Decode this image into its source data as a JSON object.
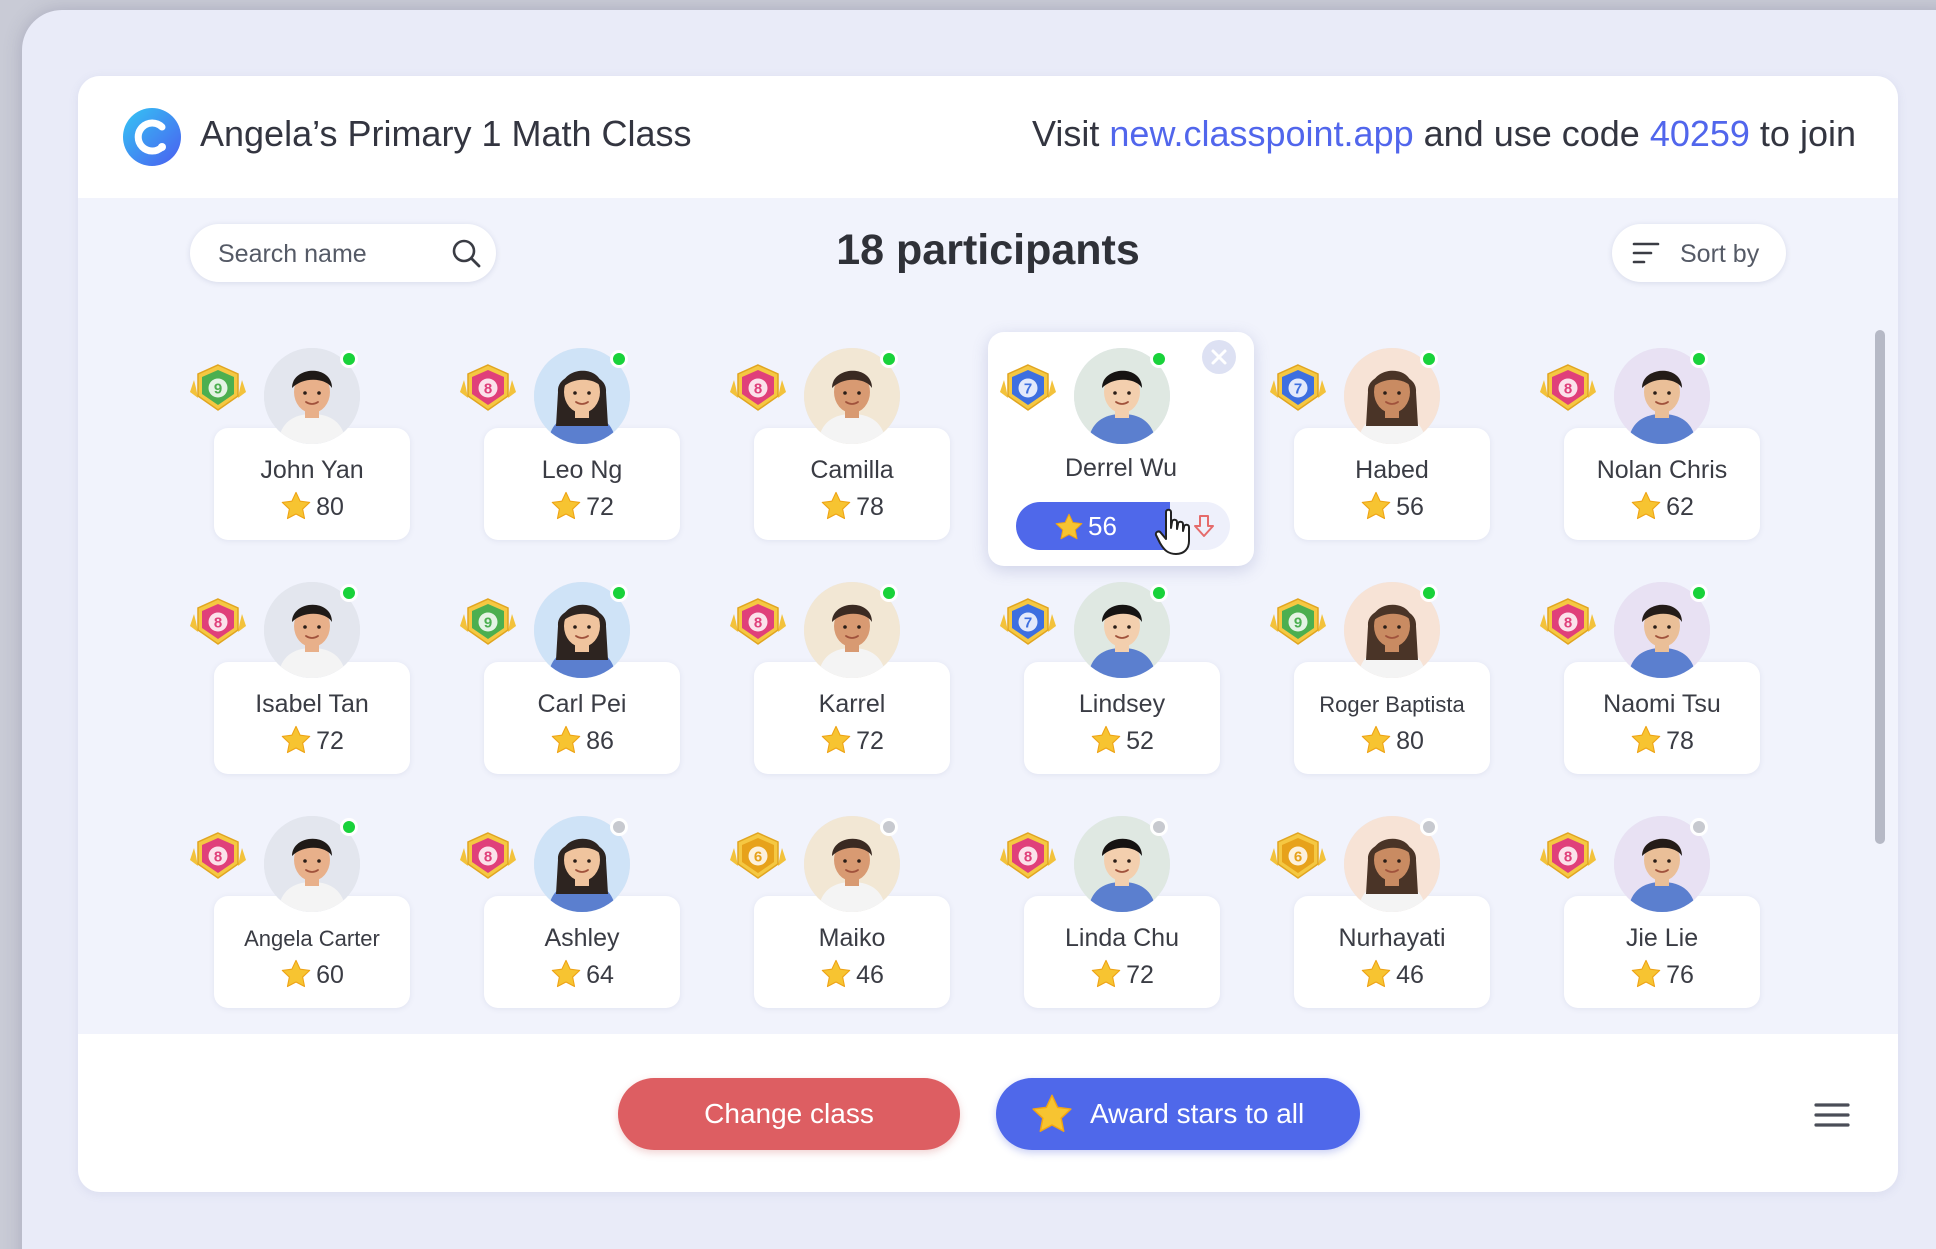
{
  "header": {
    "class_name": "Angela’s Primary 1 Math Class",
    "join_prefix": "Visit ",
    "join_url": "new.classpoint.app",
    "join_middle": " and use code ",
    "join_code": "40259",
    "join_suffix": " to join"
  },
  "toolbar": {
    "search_placeholder": "Search name",
    "participants_label": "18 participants",
    "sort_label": "Sort by"
  },
  "participants": [
    {
      "name": "John Yan",
      "stars": "80",
      "level": "9",
      "online": true
    },
    {
      "name": "Leo Ng",
      "stars": "72",
      "level": "8",
      "online": true
    },
    {
      "name": "Camilla",
      "stars": "78",
      "level": "8",
      "online": true
    },
    {
      "name": "Derrel Wu",
      "stars": "56",
      "level": "7",
      "online": true,
      "selected": true
    },
    {
      "name": "Habed",
      "stars": "56",
      "level": "7",
      "online": true
    },
    {
      "name": "Nolan Chris",
      "stars": "62",
      "level": "8",
      "online": true
    },
    {
      "name": "Isabel Tan",
      "stars": "72",
      "level": "8",
      "online": true
    },
    {
      "name": "Carl Pei",
      "stars": "86",
      "level": "9",
      "online": true
    },
    {
      "name": "Karrel",
      "stars": "72",
      "level": "8",
      "online": true
    },
    {
      "name": "Lindsey",
      "stars": "52",
      "level": "7",
      "online": true
    },
    {
      "name": "Roger Baptista",
      "stars": "80",
      "level": "9",
      "online": true
    },
    {
      "name": "Naomi Tsu",
      "stars": "78",
      "level": "8",
      "online": true
    },
    {
      "name": "Angela Carter",
      "stars": "60",
      "level": "8",
      "online": true
    },
    {
      "name": "Ashley",
      "stars": "64",
      "level": "8",
      "online": false
    },
    {
      "name": "Maiko",
      "stars": "46",
      "level": "6",
      "online": false
    },
    {
      "name": "Linda Chu",
      "stars": "72",
      "level": "8",
      "online": false
    },
    {
      "name": "Nurhayati",
      "stars": "46",
      "level": "6",
      "online": false
    },
    {
      "name": "Jie Lie",
      "stars": "76",
      "level": "8",
      "online": false
    }
  ],
  "footer": {
    "change_class_label": "Change class",
    "award_label": "Award stars to all"
  },
  "icons": {
    "logo": "classpoint-logo",
    "search": "search-icon",
    "sort": "sort-icon",
    "star": "star-icon",
    "close": "close-icon",
    "arrow_down": "arrow-down-icon",
    "menu": "hamburger-menu-icon"
  },
  "colors": {
    "accent": "#4f68ea",
    "link": "#5166ec",
    "danger": "#dd5e62",
    "online": "#19d23a",
    "offline": "#c7c9cf",
    "badge_9": "#4caf50",
    "badge_8": "#e0407a",
    "badge_7": "#3d6fe0",
    "badge_6": "#e7a21b",
    "star": "#f7b82a"
  }
}
